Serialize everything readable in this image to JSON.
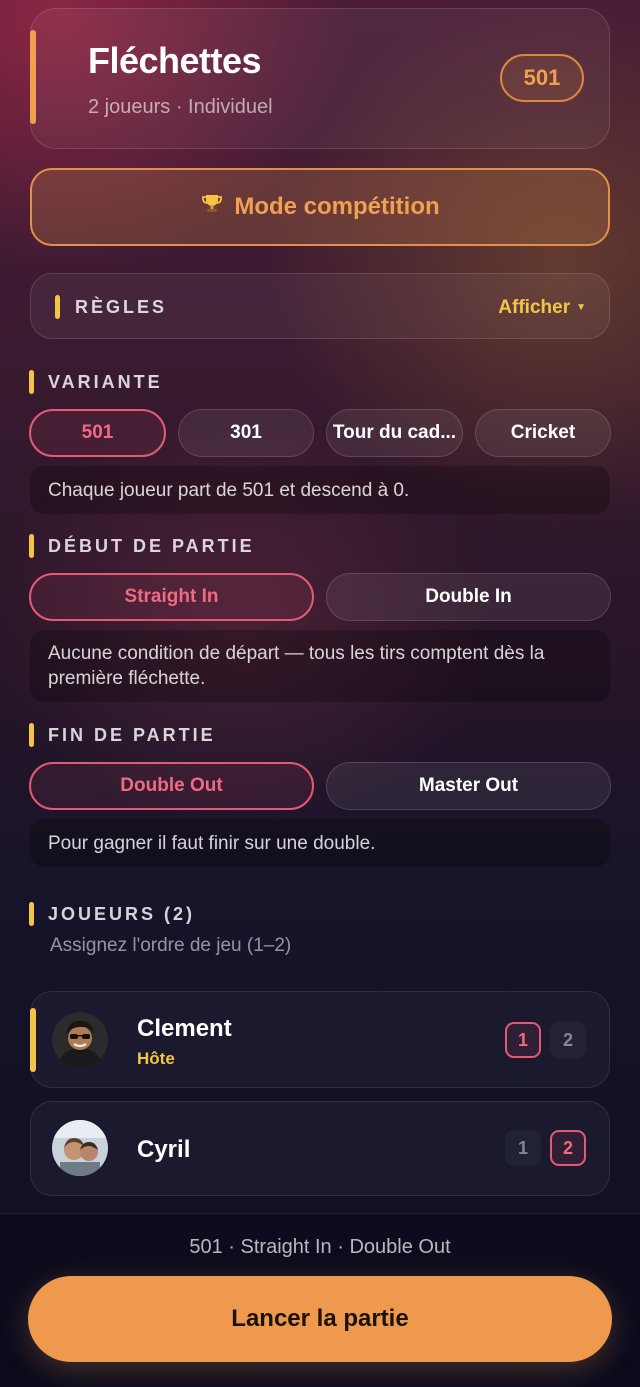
{
  "header": {
    "title": "Fléchettes",
    "subtitle": "2 joueurs · Individuel",
    "badge": "501"
  },
  "competition": {
    "icon": "trophy-icon",
    "label": "Mode compétition"
  },
  "rules": {
    "title": "RÈGLES",
    "toggle_label": "Afficher"
  },
  "variant": {
    "title": "VARIANTE",
    "options": [
      "501",
      "301",
      "Tour du cad...",
      "Cricket"
    ],
    "selected": "501",
    "description": "Chaque joueur part de 501 et descend à 0."
  },
  "start": {
    "title": "DÉBUT DE PARTIE",
    "options": [
      "Straight In",
      "Double In"
    ],
    "selected": "Straight In",
    "description": "Aucune condition de départ — tous les tirs comptent dès la première fléchette."
  },
  "finish": {
    "title": "FIN DE PARTIE",
    "options": [
      "Double Out",
      "Master Out"
    ],
    "selected": "Double Out",
    "description": "Pour gagner il faut finir sur une double."
  },
  "players": {
    "title": "JOUEURS (2)",
    "hint": "Assignez l'ordre de jeu (1–2)",
    "list": [
      {
        "name": "Clement",
        "tag": "Hôte",
        "order": 1,
        "order_options": [
          "1",
          "2"
        ]
      },
      {
        "name": "Cyril",
        "tag": "",
        "order": 2,
        "order_options": [
          "1",
          "2"
        ]
      }
    ]
  },
  "footer": {
    "summary": "501 · Straight In · Double Out",
    "launch_label": "Lancer la partie"
  },
  "colors": {
    "accent_orange": "#f0a050",
    "accent_yellow": "#f3c547",
    "selected_pink": "#e25a74",
    "launch_button": "#ef994f"
  }
}
